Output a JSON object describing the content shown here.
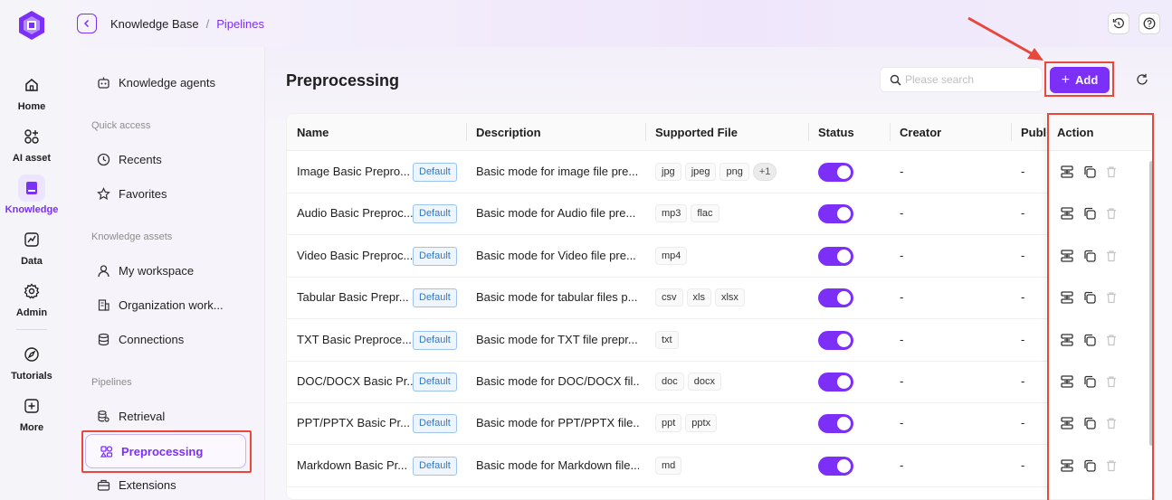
{
  "rail": {
    "items": [
      {
        "label": "Home",
        "icon": "home-icon"
      },
      {
        "label": "AI asset",
        "icon": "ai-asset-icon"
      },
      {
        "label": "Knowledge",
        "icon": "knowledge-icon",
        "active": true
      },
      {
        "label": "Data",
        "icon": "data-icon"
      },
      {
        "label": "Admin",
        "icon": "gear-icon"
      },
      {
        "label": "Tutorials",
        "icon": "compass-icon"
      },
      {
        "label": "More",
        "icon": "plus-square-icon"
      }
    ]
  },
  "topbar": {
    "crumb_root": "Knowledge Base",
    "crumb_sep": "/",
    "crumb_current": "Pipelines"
  },
  "sidebar": {
    "agents_label": "Knowledge agents",
    "quick_access_title": "Quick access",
    "recents_label": "Recents",
    "favorites_label": "Favorites",
    "assets_title": "Knowledge assets",
    "workspace_label": "My workspace",
    "org_label": "Organization work...",
    "connections_label": "Connections",
    "pipelines_title": "Pipelines",
    "retrieval_label": "Retrieval",
    "preprocessing_label": "Preprocessing",
    "extensions_label": "Extensions"
  },
  "main": {
    "title": "Preprocessing",
    "search_placeholder": "Please search",
    "add_label": "Add",
    "add_icon": "+"
  },
  "table": {
    "headers": {
      "name": "Name",
      "description": "Description",
      "supported": "Supported File",
      "status": "Status",
      "creator": "Creator",
      "public": "Publi",
      "action": "Action"
    },
    "rows": [
      {
        "name": "Image Basic Prepro...",
        "badge": "Default",
        "description": "Basic mode for image file pre...",
        "tags": [
          "jpg",
          "jpeg",
          "png"
        ],
        "more": "+1",
        "status_on": true,
        "creator": "-",
        "public": "-"
      },
      {
        "name": "Audio Basic Preproc...",
        "badge": "Default",
        "description": "Basic mode for Audio file pre...",
        "tags": [
          "mp3",
          "flac"
        ],
        "more": "",
        "status_on": true,
        "creator": "-",
        "public": "-"
      },
      {
        "name": "Video Basic Preproc...",
        "badge": "Default",
        "description": "Basic mode for Video file pre...",
        "tags": [
          "mp4"
        ],
        "more": "",
        "status_on": true,
        "creator": "-",
        "public": "-"
      },
      {
        "name": "Tabular Basic Prepr...",
        "badge": "Default",
        "description": "Basic mode for tabular files p...",
        "tags": [
          "csv",
          "xls",
          "xlsx"
        ],
        "more": "",
        "status_on": true,
        "creator": "-",
        "public": "-"
      },
      {
        "name": "TXT Basic Preproce...",
        "badge": "Default",
        "description": "Basic mode for TXT file prepr...",
        "tags": [
          "txt"
        ],
        "more": "",
        "status_on": true,
        "creator": "-",
        "public": "-"
      },
      {
        "name": "DOC/DOCX Basic Pr...",
        "badge": "Default",
        "description": "Basic mode for DOC/DOCX fil...",
        "tags": [
          "doc",
          "docx"
        ],
        "more": "",
        "status_on": true,
        "creator": "-",
        "public": "-"
      },
      {
        "name": "PPT/PPTX Basic Pr...",
        "badge": "Default",
        "description": "Basic mode for PPT/PPTX file...",
        "tags": [
          "ppt",
          "pptx"
        ],
        "more": "",
        "status_on": true,
        "creator": "-",
        "public": "-"
      },
      {
        "name": "Markdown Basic Pr...",
        "badge": "Default",
        "description": "Basic mode for Markdown file...",
        "tags": [
          "md"
        ],
        "more": "",
        "status_on": true,
        "creator": "-",
        "public": "-"
      }
    ]
  },
  "colors": {
    "accent": "#7b2ff7",
    "highlight": "#e8473b",
    "badge_border": "#9cc3ef"
  }
}
